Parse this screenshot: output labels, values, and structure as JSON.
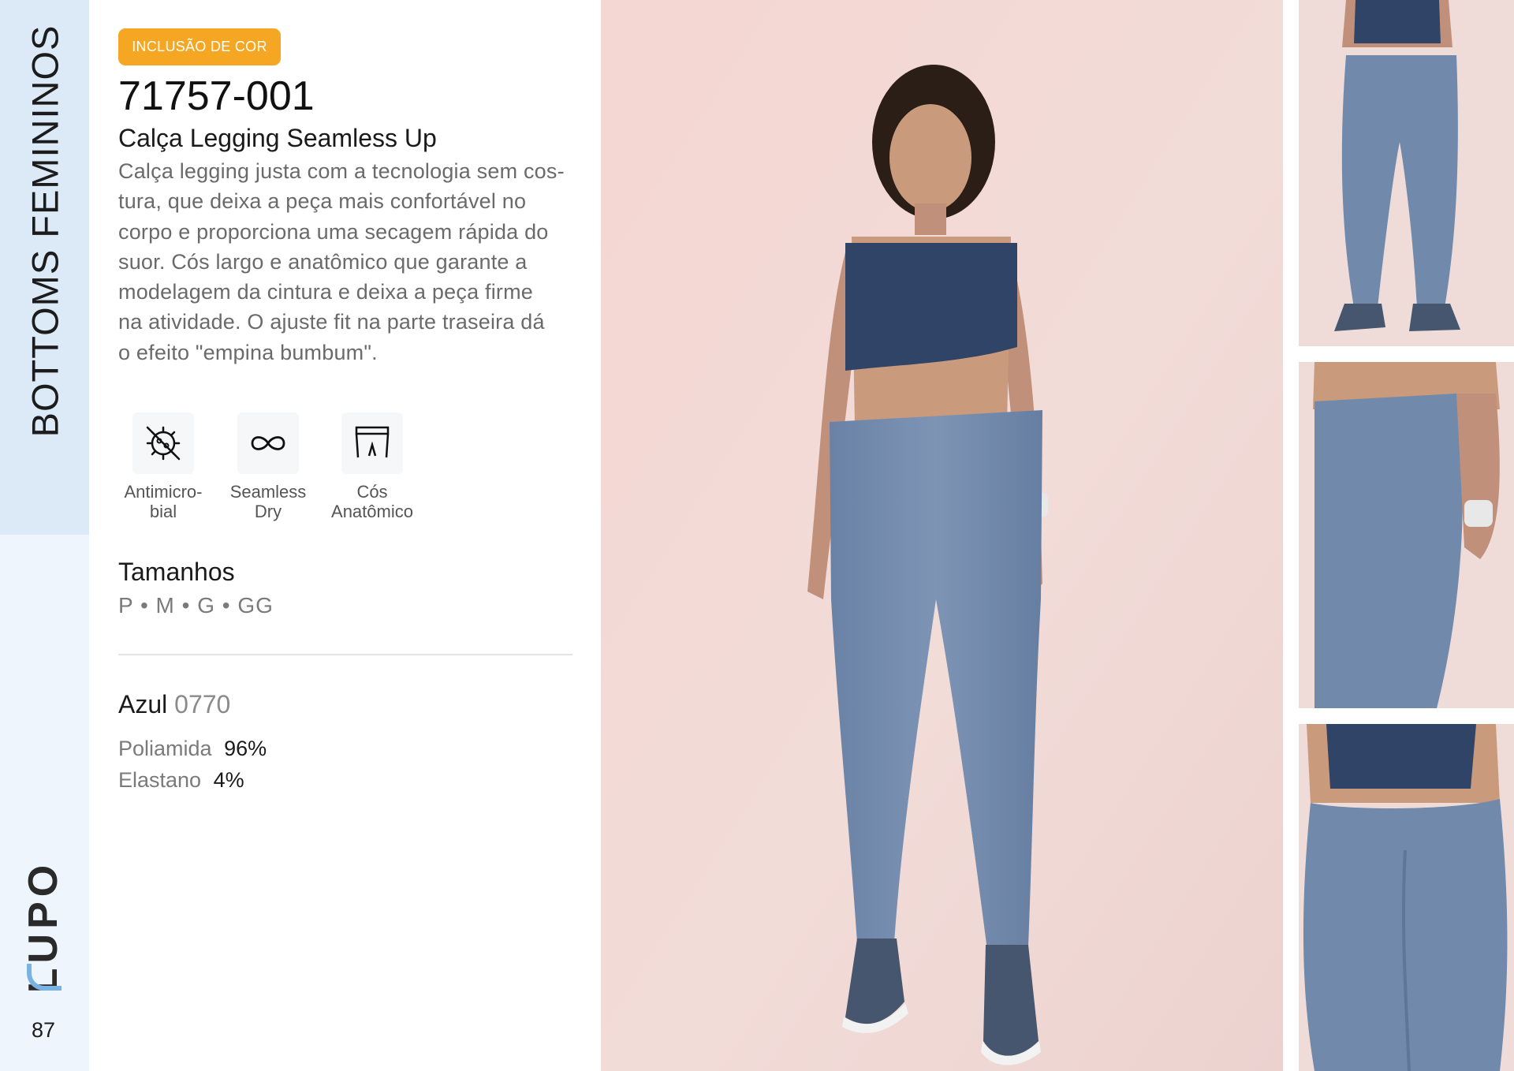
{
  "sidebar": {
    "category": "BOTTOMS FEMININOS",
    "logo": "LUPO",
    "page_number": "87"
  },
  "product": {
    "badge": "INCLUSÃO DE COR",
    "code": "71757-001",
    "name": "Calça Legging Seamless Up",
    "description_lines": [
      "Calça legging justa com a tecnologia sem cos-",
      "tura, que deixa a peça mais confortável no",
      "corpo e proporciona uma secagem rápida do",
      "suor. Cós largo e anatômico que garante a",
      "modelagem da cintura e deixa a peça firme",
      "na atividade. O ajuste fit na parte traseira dá",
      "o efeito \"empina bumbum\"."
    ]
  },
  "features": [
    {
      "icon": "antimicrobial-icon",
      "label_line1": "Antimicro-",
      "label_line2": "bial"
    },
    {
      "icon": "infinity-icon",
      "label_line1": "Seamless",
      "label_line2": "Dry"
    },
    {
      "icon": "waistband-icon",
      "label_line1": "Cós",
      "label_line2": "Anatômico"
    }
  ],
  "sizes": {
    "title": "Tamanhos",
    "values": "P • M • G • GG"
  },
  "color": {
    "name": "Azul",
    "code": "0770"
  },
  "composition": [
    {
      "material": "Poliamida",
      "percent": "96%"
    },
    {
      "material": "Elastano",
      "percent": "4%"
    }
  ],
  "colors": {
    "badge": "#f5a623",
    "sidebar_top": "#dce9f7",
    "sidebar_bottom": "#eef5fc",
    "legging": "#7189ab",
    "top": "#2f4466",
    "background_photo": "#f2d9d6"
  }
}
